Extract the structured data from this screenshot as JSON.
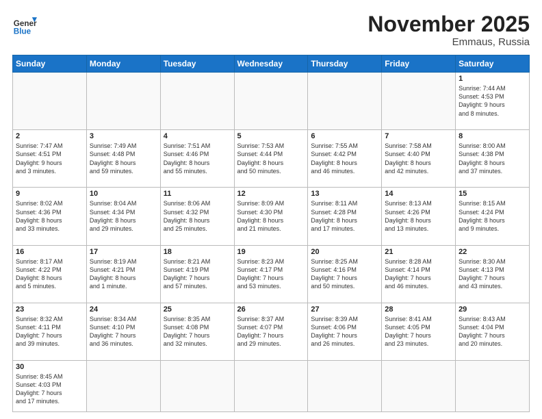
{
  "header": {
    "logo_general": "General",
    "logo_blue": "Blue",
    "month_title": "November 2025",
    "location": "Emmaus, Russia"
  },
  "days_of_week": [
    "Sunday",
    "Monday",
    "Tuesday",
    "Wednesday",
    "Thursday",
    "Friday",
    "Saturday"
  ],
  "weeks": [
    [
      {
        "day": "",
        "info": ""
      },
      {
        "day": "",
        "info": ""
      },
      {
        "day": "",
        "info": ""
      },
      {
        "day": "",
        "info": ""
      },
      {
        "day": "",
        "info": ""
      },
      {
        "day": "",
        "info": ""
      },
      {
        "day": "1",
        "info": "Sunrise: 7:44 AM\nSunset: 4:53 PM\nDaylight: 9 hours\nand 8 minutes."
      }
    ],
    [
      {
        "day": "2",
        "info": "Sunrise: 7:47 AM\nSunset: 4:51 PM\nDaylight: 9 hours\nand 3 minutes."
      },
      {
        "day": "3",
        "info": "Sunrise: 7:49 AM\nSunset: 4:48 PM\nDaylight: 8 hours\nand 59 minutes."
      },
      {
        "day": "4",
        "info": "Sunrise: 7:51 AM\nSunset: 4:46 PM\nDaylight: 8 hours\nand 55 minutes."
      },
      {
        "day": "5",
        "info": "Sunrise: 7:53 AM\nSunset: 4:44 PM\nDaylight: 8 hours\nand 50 minutes."
      },
      {
        "day": "6",
        "info": "Sunrise: 7:55 AM\nSunset: 4:42 PM\nDaylight: 8 hours\nand 46 minutes."
      },
      {
        "day": "7",
        "info": "Sunrise: 7:58 AM\nSunset: 4:40 PM\nDaylight: 8 hours\nand 42 minutes."
      },
      {
        "day": "8",
        "info": "Sunrise: 8:00 AM\nSunset: 4:38 PM\nDaylight: 8 hours\nand 37 minutes."
      }
    ],
    [
      {
        "day": "9",
        "info": "Sunrise: 8:02 AM\nSunset: 4:36 PM\nDaylight: 8 hours\nand 33 minutes."
      },
      {
        "day": "10",
        "info": "Sunrise: 8:04 AM\nSunset: 4:34 PM\nDaylight: 8 hours\nand 29 minutes."
      },
      {
        "day": "11",
        "info": "Sunrise: 8:06 AM\nSunset: 4:32 PM\nDaylight: 8 hours\nand 25 minutes."
      },
      {
        "day": "12",
        "info": "Sunrise: 8:09 AM\nSunset: 4:30 PM\nDaylight: 8 hours\nand 21 minutes."
      },
      {
        "day": "13",
        "info": "Sunrise: 8:11 AM\nSunset: 4:28 PM\nDaylight: 8 hours\nand 17 minutes."
      },
      {
        "day": "14",
        "info": "Sunrise: 8:13 AM\nSunset: 4:26 PM\nDaylight: 8 hours\nand 13 minutes."
      },
      {
        "day": "15",
        "info": "Sunrise: 8:15 AM\nSunset: 4:24 PM\nDaylight: 8 hours\nand 9 minutes."
      }
    ],
    [
      {
        "day": "16",
        "info": "Sunrise: 8:17 AM\nSunset: 4:22 PM\nDaylight: 8 hours\nand 5 minutes."
      },
      {
        "day": "17",
        "info": "Sunrise: 8:19 AM\nSunset: 4:21 PM\nDaylight: 8 hours\nand 1 minute."
      },
      {
        "day": "18",
        "info": "Sunrise: 8:21 AM\nSunset: 4:19 PM\nDaylight: 7 hours\nand 57 minutes."
      },
      {
        "day": "19",
        "info": "Sunrise: 8:23 AM\nSunset: 4:17 PM\nDaylight: 7 hours\nand 53 minutes."
      },
      {
        "day": "20",
        "info": "Sunrise: 8:25 AM\nSunset: 4:16 PM\nDaylight: 7 hours\nand 50 minutes."
      },
      {
        "day": "21",
        "info": "Sunrise: 8:28 AM\nSunset: 4:14 PM\nDaylight: 7 hours\nand 46 minutes."
      },
      {
        "day": "22",
        "info": "Sunrise: 8:30 AM\nSunset: 4:13 PM\nDaylight: 7 hours\nand 43 minutes."
      }
    ],
    [
      {
        "day": "23",
        "info": "Sunrise: 8:32 AM\nSunset: 4:11 PM\nDaylight: 7 hours\nand 39 minutes."
      },
      {
        "day": "24",
        "info": "Sunrise: 8:34 AM\nSunset: 4:10 PM\nDaylight: 7 hours\nand 36 minutes."
      },
      {
        "day": "25",
        "info": "Sunrise: 8:35 AM\nSunset: 4:08 PM\nDaylight: 7 hours\nand 32 minutes."
      },
      {
        "day": "26",
        "info": "Sunrise: 8:37 AM\nSunset: 4:07 PM\nDaylight: 7 hours\nand 29 minutes."
      },
      {
        "day": "27",
        "info": "Sunrise: 8:39 AM\nSunset: 4:06 PM\nDaylight: 7 hours\nand 26 minutes."
      },
      {
        "day": "28",
        "info": "Sunrise: 8:41 AM\nSunset: 4:05 PM\nDaylight: 7 hours\nand 23 minutes."
      },
      {
        "day": "29",
        "info": "Sunrise: 8:43 AM\nSunset: 4:04 PM\nDaylight: 7 hours\nand 20 minutes."
      }
    ],
    [
      {
        "day": "30",
        "info": "Sunrise: 8:45 AM\nSunset: 4:03 PM\nDaylight: 7 hours\nand 17 minutes."
      },
      {
        "day": "",
        "info": ""
      },
      {
        "day": "",
        "info": ""
      },
      {
        "day": "",
        "info": ""
      },
      {
        "day": "",
        "info": ""
      },
      {
        "day": "",
        "info": ""
      },
      {
        "day": "",
        "info": ""
      }
    ]
  ]
}
